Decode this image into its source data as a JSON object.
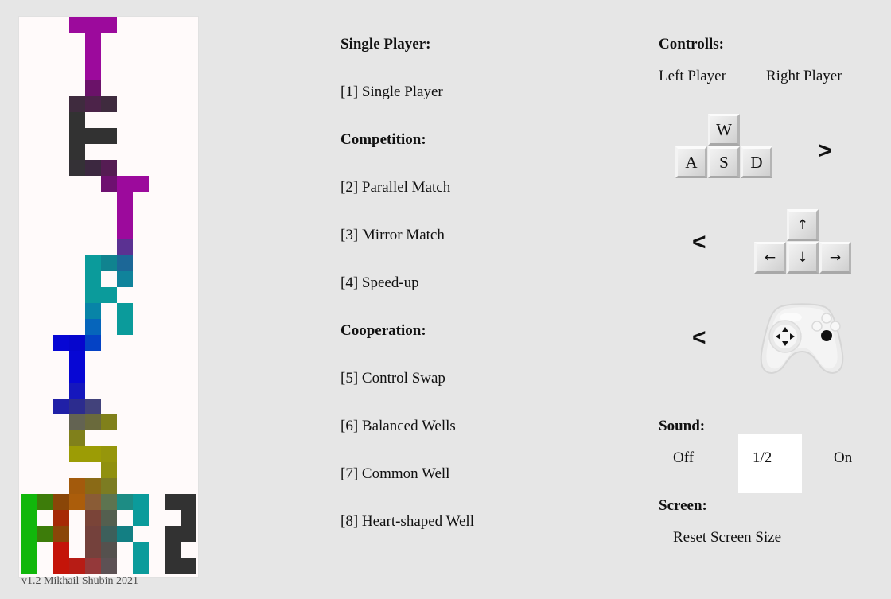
{
  "window": {
    "background_color": "#e6e6e6",
    "panel_color": "#fffafa"
  },
  "tetris_panel": {
    "name": "tetris-well-preview",
    "version_text": "v1.2 Mikhail Shubin 2021",
    "cell_size": 20,
    "columns": 11,
    "rows": 35,
    "blocks": [
      {
        "c": 3,
        "r": 0,
        "color": "#9c0a9c"
      },
      {
        "c": 4,
        "r": 0,
        "color": "#9c0a9c"
      },
      {
        "c": 5,
        "r": 0,
        "color": "#9c0a9c"
      },
      {
        "c": 4,
        "r": 1,
        "color": "#9c0a9c"
      },
      {
        "c": 4,
        "r": 2,
        "color": "#9c0a9c"
      },
      {
        "c": 4,
        "r": 3,
        "color": "#9c0a9c"
      },
      {
        "c": 4,
        "r": 4,
        "color": "#6b1269"
      },
      {
        "c": 3,
        "r": 5,
        "color": "#3f2b3e"
      },
      {
        "c": 4,
        "r": 5,
        "color": "#4c2349"
      },
      {
        "c": 5,
        "r": 5,
        "color": "#3f2b3e"
      },
      {
        "c": 3,
        "r": 6,
        "color": "#323232"
      },
      {
        "c": 3,
        "r": 7,
        "color": "#323232"
      },
      {
        "c": 4,
        "r": 7,
        "color": "#323232"
      },
      {
        "c": 5,
        "r": 7,
        "color": "#323232"
      },
      {
        "c": 3,
        "r": 8,
        "color": "#323232"
      },
      {
        "c": 3,
        "r": 9,
        "color": "#343136"
      },
      {
        "c": 4,
        "r": 9,
        "color": "#3c2840"
      },
      {
        "c": 5,
        "r": 9,
        "color": "#551c53"
      },
      {
        "c": 5,
        "r": 10,
        "color": "#6e1070"
      },
      {
        "c": 6,
        "r": 10,
        "color": "#9c0a9c"
      },
      {
        "c": 7,
        "r": 10,
        "color": "#9c0a9c"
      },
      {
        "c": 6,
        "r": 11,
        "color": "#9c0a9c"
      },
      {
        "c": 6,
        "r": 12,
        "color": "#9c0a9c"
      },
      {
        "c": 6,
        "r": 13,
        "color": "#9c0a9c"
      },
      {
        "c": 6,
        "r": 14,
        "color": "#5b3192"
      },
      {
        "c": 4,
        "r": 15,
        "color": "#0b9b9b"
      },
      {
        "c": 5,
        "r": 15,
        "color": "#10838f"
      },
      {
        "c": 6,
        "r": 15,
        "color": "#1c6797"
      },
      {
        "c": 4,
        "r": 16,
        "color": "#0b9b9b"
      },
      {
        "c": 6,
        "r": 16,
        "color": "#10839b"
      },
      {
        "c": 4,
        "r": 17,
        "color": "#0b9b9b"
      },
      {
        "c": 5,
        "r": 17,
        "color": "#0b9b9b"
      },
      {
        "c": 4,
        "r": 18,
        "color": "#0884a7"
      },
      {
        "c": 6,
        "r": 18,
        "color": "#0b9b9b"
      },
      {
        "c": 4,
        "r": 19,
        "color": "#0665bb"
      },
      {
        "c": 6,
        "r": 19,
        "color": "#0b9b9b"
      },
      {
        "c": 2,
        "r": 20,
        "color": "#0707d4"
      },
      {
        "c": 3,
        "r": 20,
        "color": "#0606cd"
      },
      {
        "c": 4,
        "r": 20,
        "color": "#0442c5"
      },
      {
        "c": 3,
        "r": 21,
        "color": "#0707d4"
      },
      {
        "c": 3,
        "r": 22,
        "color": "#0707d4"
      },
      {
        "c": 3,
        "r": 23,
        "color": "#1517bd"
      },
      {
        "c": 2,
        "r": 24,
        "color": "#2020a7"
      },
      {
        "c": 3,
        "r": 24,
        "color": "#2c2c8e"
      },
      {
        "c": 4,
        "r": 24,
        "color": "#42427b"
      },
      {
        "c": 3,
        "r": 25,
        "color": "#636352"
      },
      {
        "c": 4,
        "r": 25,
        "color": "#6a6a3c"
      },
      {
        "c": 5,
        "r": 25,
        "color": "#80801b"
      },
      {
        "c": 3,
        "r": 26,
        "color": "#80801b"
      },
      {
        "c": 3,
        "r": 27,
        "color": "#9c9c05"
      },
      {
        "c": 4,
        "r": 27,
        "color": "#9c9c05"
      },
      {
        "c": 5,
        "r": 27,
        "color": "#96960b"
      },
      {
        "c": 5,
        "r": 28,
        "color": "#90900f"
      },
      {
        "c": 3,
        "r": 29,
        "color": "#a35a0c"
      },
      {
        "c": 4,
        "r": 29,
        "color": "#8a6a16"
      },
      {
        "c": 5,
        "r": 29,
        "color": "#7c7c22"
      },
      {
        "c": 0,
        "r": 30,
        "color": "#11b70b"
      },
      {
        "c": 1,
        "r": 30,
        "color": "#3d7c0a"
      },
      {
        "c": 2,
        "r": 30,
        "color": "#8a4608"
      },
      {
        "c": 3,
        "r": 30,
        "color": "#ab5d0b"
      },
      {
        "c": 4,
        "r": 30,
        "color": "#8a5c36"
      },
      {
        "c": 5,
        "r": 30,
        "color": "#5d7450"
      },
      {
        "c": 6,
        "r": 30,
        "color": "#1d8c84"
      },
      {
        "c": 7,
        "r": 30,
        "color": "#0b9b9b"
      },
      {
        "c": 9,
        "r": 30,
        "color": "#323232"
      },
      {
        "c": 10,
        "r": 30,
        "color": "#323232"
      },
      {
        "c": 0,
        "r": 31,
        "color": "#11b70b"
      },
      {
        "c": 2,
        "r": 31,
        "color": "#a62a06"
      },
      {
        "c": 4,
        "r": 31,
        "color": "#7a4438"
      },
      {
        "c": 5,
        "r": 31,
        "color": "#545f4f"
      },
      {
        "c": 7,
        "r": 31,
        "color": "#0b9b9b"
      },
      {
        "c": 10,
        "r": 31,
        "color": "#323232"
      },
      {
        "c": 0,
        "r": 32,
        "color": "#11b70b"
      },
      {
        "c": 1,
        "r": 32,
        "color": "#3d7c0a"
      },
      {
        "c": 2,
        "r": 32,
        "color": "#8a4608"
      },
      {
        "c": 4,
        "r": 32,
        "color": "#74413c"
      },
      {
        "c": 5,
        "r": 32,
        "color": "#3d5f5b"
      },
      {
        "c": 6,
        "r": 32,
        "color": "#137f83"
      },
      {
        "c": 9,
        "r": 32,
        "color": "#323232"
      },
      {
        "c": 10,
        "r": 32,
        "color": "#323232"
      },
      {
        "c": 0,
        "r": 33,
        "color": "#11b70b"
      },
      {
        "c": 2,
        "r": 33,
        "color": "#c41409"
      },
      {
        "c": 4,
        "r": 33,
        "color": "#74413c"
      },
      {
        "c": 5,
        "r": 33,
        "color": "#55514e"
      },
      {
        "c": 7,
        "r": 33,
        "color": "#0b9b9b"
      },
      {
        "c": 9,
        "r": 33,
        "color": "#323232"
      },
      {
        "c": 0,
        "r": 34,
        "color": "#11b70b"
      },
      {
        "c": 2,
        "r": 34,
        "color": "#c41409"
      },
      {
        "c": 3,
        "r": 34,
        "color": "#b71c15"
      },
      {
        "c": 4,
        "r": 34,
        "color": "#94393a"
      },
      {
        "c": 5,
        "r": 34,
        "color": "#5d5154"
      },
      {
        "c": 7,
        "r": 34,
        "color": "#0b9b9b"
      },
      {
        "c": 9,
        "r": 34,
        "color": "#323232"
      },
      {
        "c": 10,
        "r": 34,
        "color": "#323232"
      }
    ]
  },
  "menu": {
    "sections": [
      {
        "heading": "Single Player:"
      },
      {
        "heading": "Competition:"
      },
      {
        "heading": "Cooperation:"
      }
    ],
    "heading_single_player": "Single Player:",
    "heading_competition": "Competition:",
    "heading_cooperation": "Cooperation:",
    "items": [
      {
        "label": "[1] Single Player",
        "key": "1"
      },
      {
        "label": "[2] Parallel Match",
        "key": "2"
      },
      {
        "label": "[3] Mirror Match",
        "key": "3"
      },
      {
        "label": "[4] Speed-up",
        "key": "4"
      },
      {
        "label": "[5] Control Swap",
        "key": "5"
      },
      {
        "label": "[6] Balanced Wells",
        "key": "6"
      },
      {
        "label": "[7] Common Well",
        "key": "7"
      },
      {
        "label": "[8] Heart-shaped Well",
        "key": "8"
      }
    ]
  },
  "controls": {
    "heading": "Controlls:",
    "left_player_label": "Left Player",
    "right_player_label": "Right Player",
    "wasd_keys": [
      "W",
      "A",
      "S",
      "D"
    ],
    "arrow_keys": [
      "↑",
      "←",
      "↓",
      "→"
    ],
    "chevron_right": ">",
    "chevron_left_arrows": "<",
    "chevron_left_gamepad": "<",
    "gamepad_name": "gamepad-icon"
  },
  "sound": {
    "heading": "Sound:",
    "options": [
      "Off",
      "1/2",
      "On"
    ],
    "selected": "1/2",
    "selected_background": "#ffffff"
  },
  "screen": {
    "heading": "Screen:",
    "reset_label": "Reset Screen Size"
  }
}
